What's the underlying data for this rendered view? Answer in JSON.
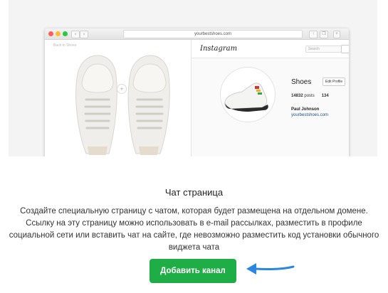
{
  "browser": {
    "url": "yourbestshoes.com",
    "back_link": "Back to Shoes",
    "back_icon": "chevron-left-icon",
    "forward_icon": "chevron-right-icon",
    "share_icon": "share-icon",
    "tabs_icon": "tabs-icon",
    "plus_icon": "plus-icon"
  },
  "instagram": {
    "logo": "Instagram",
    "search_placeholder": "Search",
    "profile_name": "Shoes",
    "edit_profile": "Edit Profile",
    "posts_count": "14832",
    "posts_label": "posts",
    "followers_partial": "134",
    "person_name": "Paul Johnson",
    "website": "yourbestshoes.com"
  },
  "content": {
    "heading": "Чат страница",
    "description": "Создайте специальную страницу с чатом, которая будет размещена на отдельном домене. Ссылку на эту страницу можно использовать в e-mail рассылках, разместить в профиле социальной сети или вставить чат на сайте, где невозможно разместить код установки обычного виджета чата",
    "button_label": "Добавить канал"
  },
  "colors": {
    "button": "#1fae45",
    "arrow": "#2a86e0",
    "link": "#1b4f8a"
  }
}
